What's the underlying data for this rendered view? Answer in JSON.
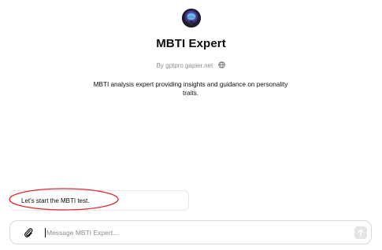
{
  "gpt": {
    "name": "MBTI Expert",
    "byline": "By gptpro.gapier.net",
    "description": "MBTI analysis expert providing insights and guidance on personality traits.",
    "avatar_icon": "brain-avatar-icon"
  },
  "suggestion": {
    "label": "Let's start the MBTI test."
  },
  "composer": {
    "placeholder": "Message MBTI Expert...",
    "value": "",
    "attach_icon": "paperclip-icon",
    "send_icon": "arrow-up-icon"
  },
  "colors": {
    "highlight_circle": "#e0282e",
    "muted_text": "#8e8e8e",
    "send_button_disabled": "#e5e5e5"
  }
}
